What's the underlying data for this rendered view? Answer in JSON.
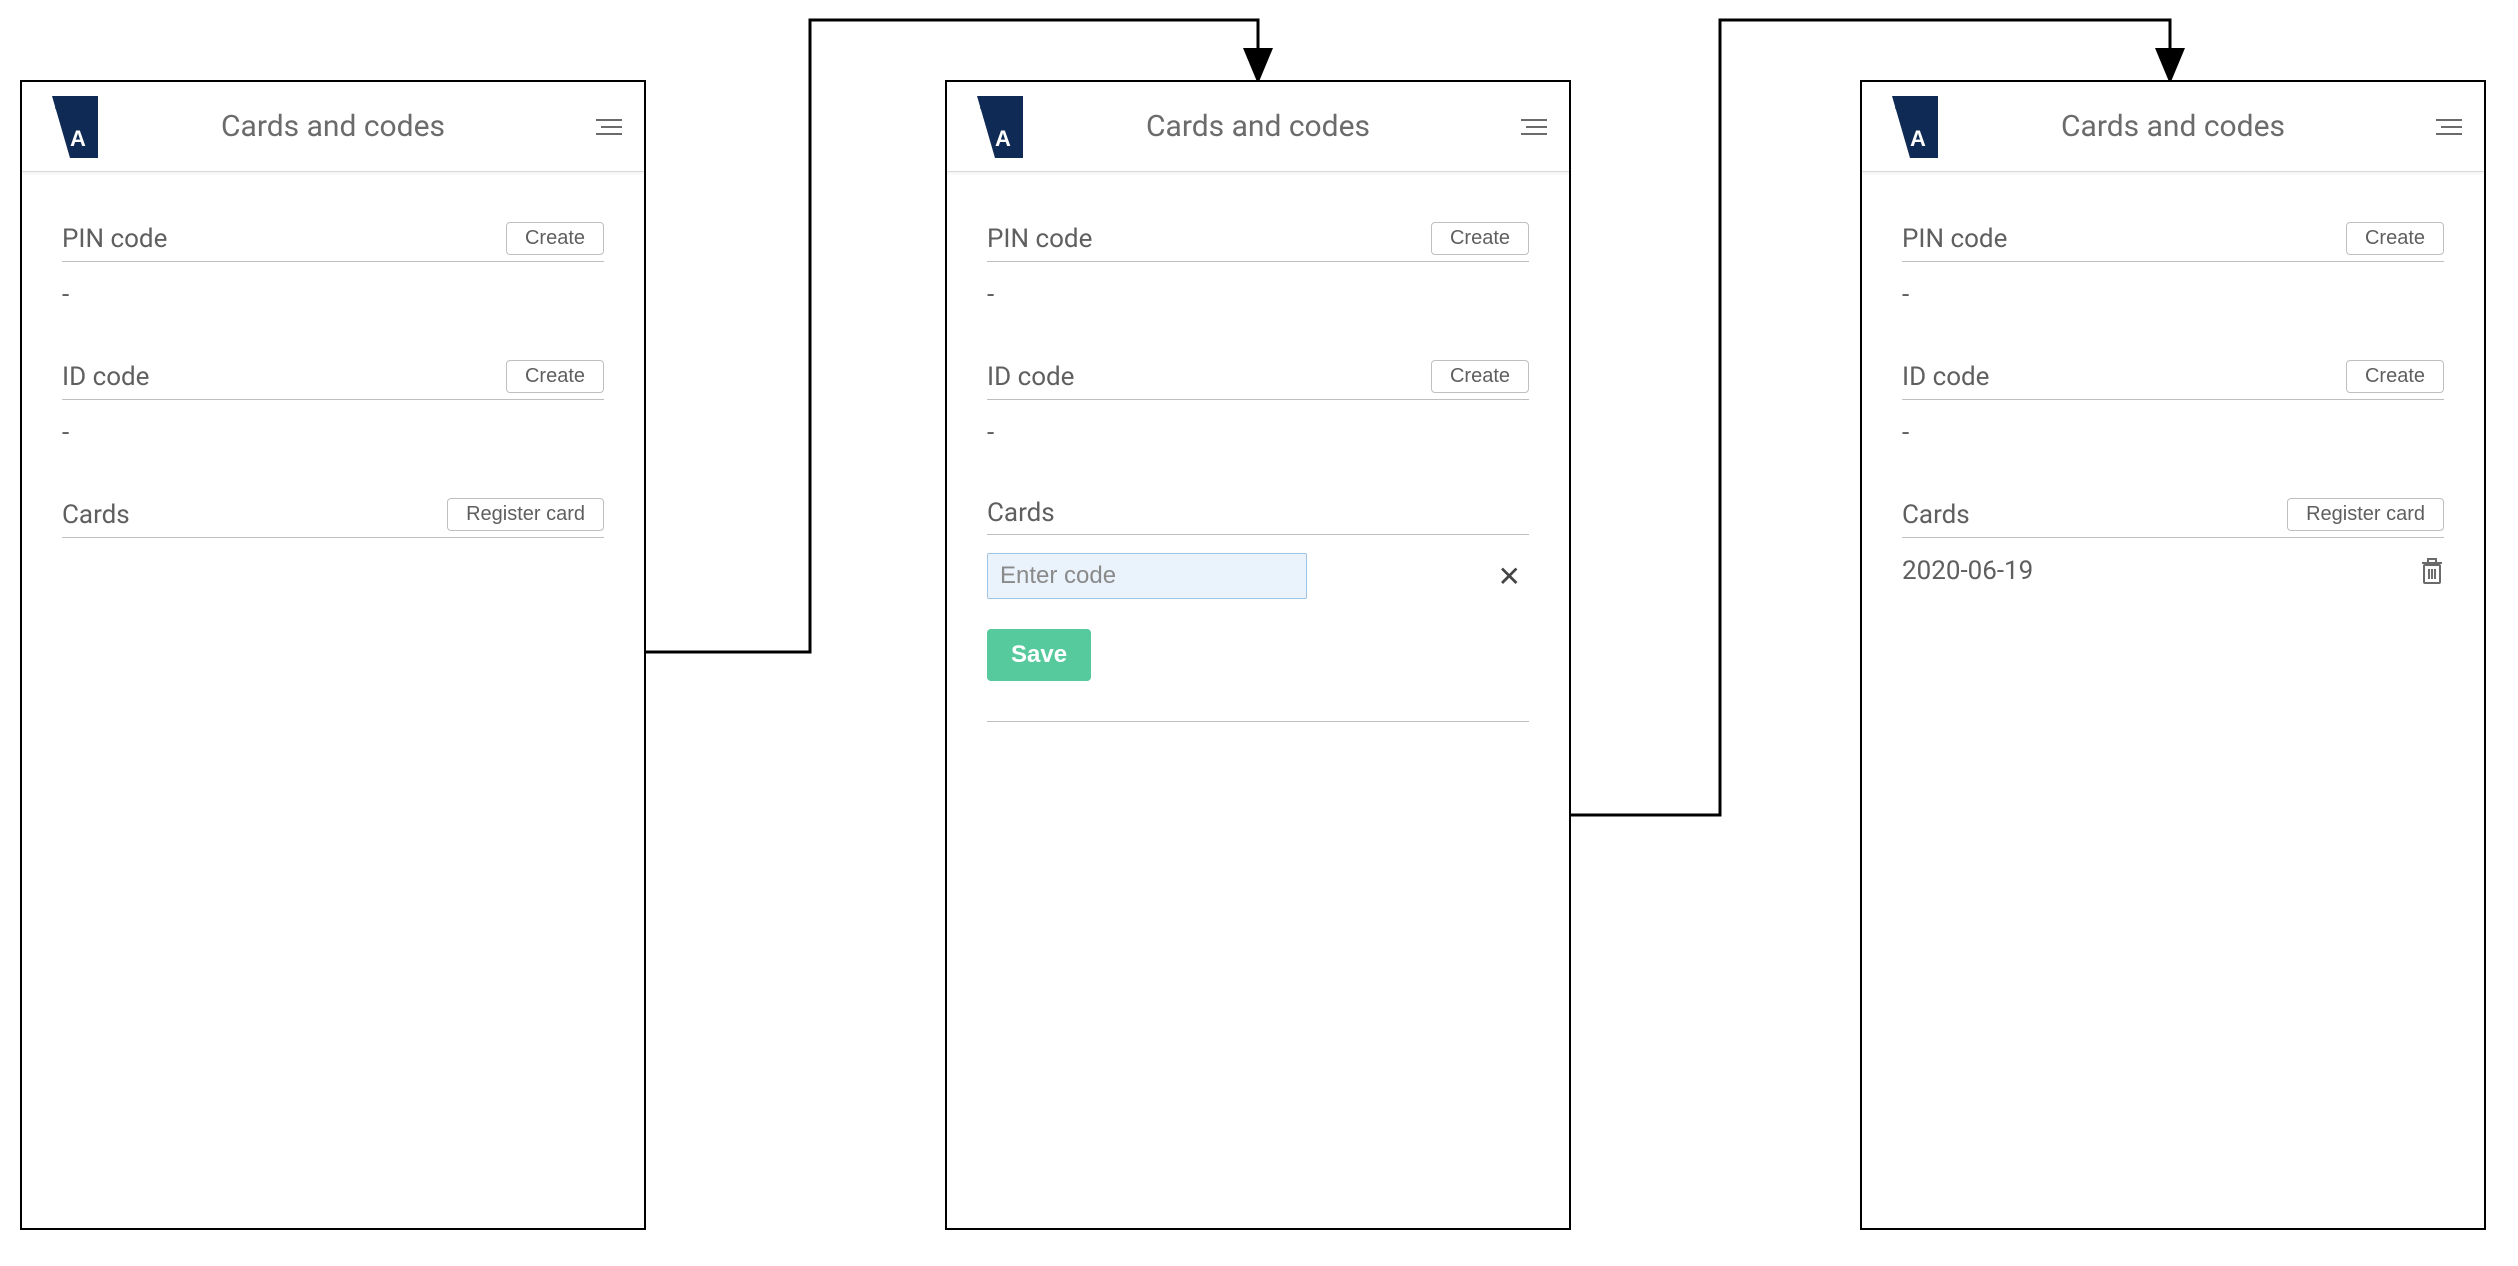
{
  "header": {
    "title": "Cards and codes"
  },
  "sections": {
    "pin": {
      "label": "PIN code",
      "button": "Create",
      "value": "-"
    },
    "id": {
      "label": "ID code",
      "button": "Create",
      "value": "-"
    },
    "cards": {
      "label": "Cards",
      "register_button": "Register card"
    }
  },
  "enter_code": {
    "placeholder": "Enter code",
    "save_button": "Save"
  },
  "registered_card": {
    "date": "2020-06-19"
  },
  "colors": {
    "logo_dark": "#0f2b55",
    "save_green": "#56c99d"
  }
}
